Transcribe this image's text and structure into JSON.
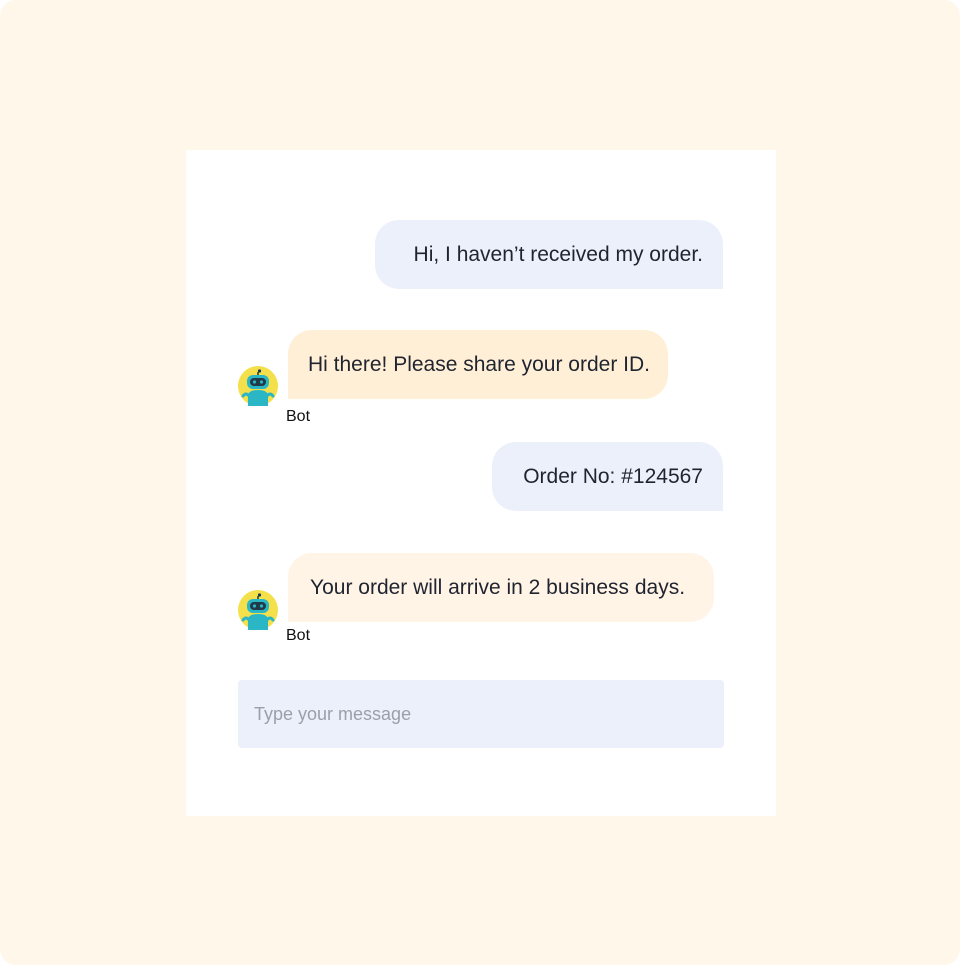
{
  "messages": [
    {
      "sender": "user",
      "text": "Hi, I haven’t received my order."
    },
    {
      "sender": "bot",
      "sender_label": "Bot",
      "text": "Hi there! Please share your order ID."
    },
    {
      "sender": "user",
      "text": "Order No: #124567"
    },
    {
      "sender": "bot",
      "sender_label": "Bot",
      "text": "Your order will arrive in 2 business days."
    }
  ],
  "composer": {
    "placeholder": "Type your message",
    "value": ""
  },
  "colors": {
    "background": "#FFF7EA",
    "card": "#FFFFFF",
    "user_bubble": "#ECF0FB",
    "bot_bubble": "#FFEFD6",
    "input": "#ECF0FB"
  },
  "icons": {
    "bot_avatar": "robot-avatar-icon"
  }
}
